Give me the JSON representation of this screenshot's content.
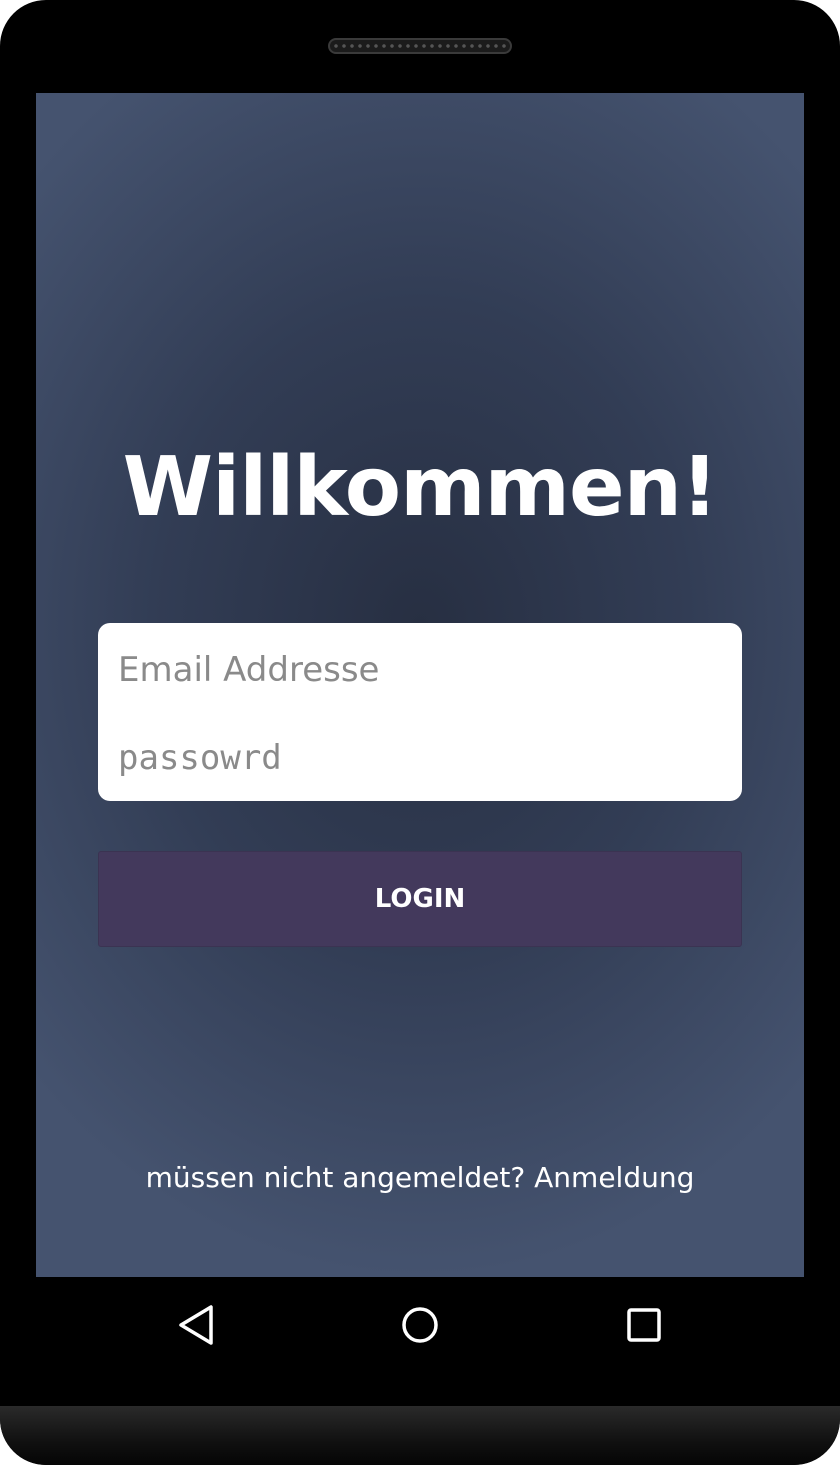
{
  "screen": {
    "title": "Willkommen!",
    "email": {
      "placeholder": "Email Addresse",
      "value": ""
    },
    "password": {
      "placeholder": "passowrd",
      "value": ""
    },
    "login_label": "LOGIN",
    "signup_link": "müssen nicht angemeldet? Anmeldung"
  },
  "navbar": {
    "back_icon": "triangle-back-icon",
    "home_icon": "circle-home-icon",
    "recents_icon": "square-recents-icon"
  },
  "colors": {
    "background": "#323d55",
    "button": "#43395c",
    "card": "#ffffff"
  }
}
